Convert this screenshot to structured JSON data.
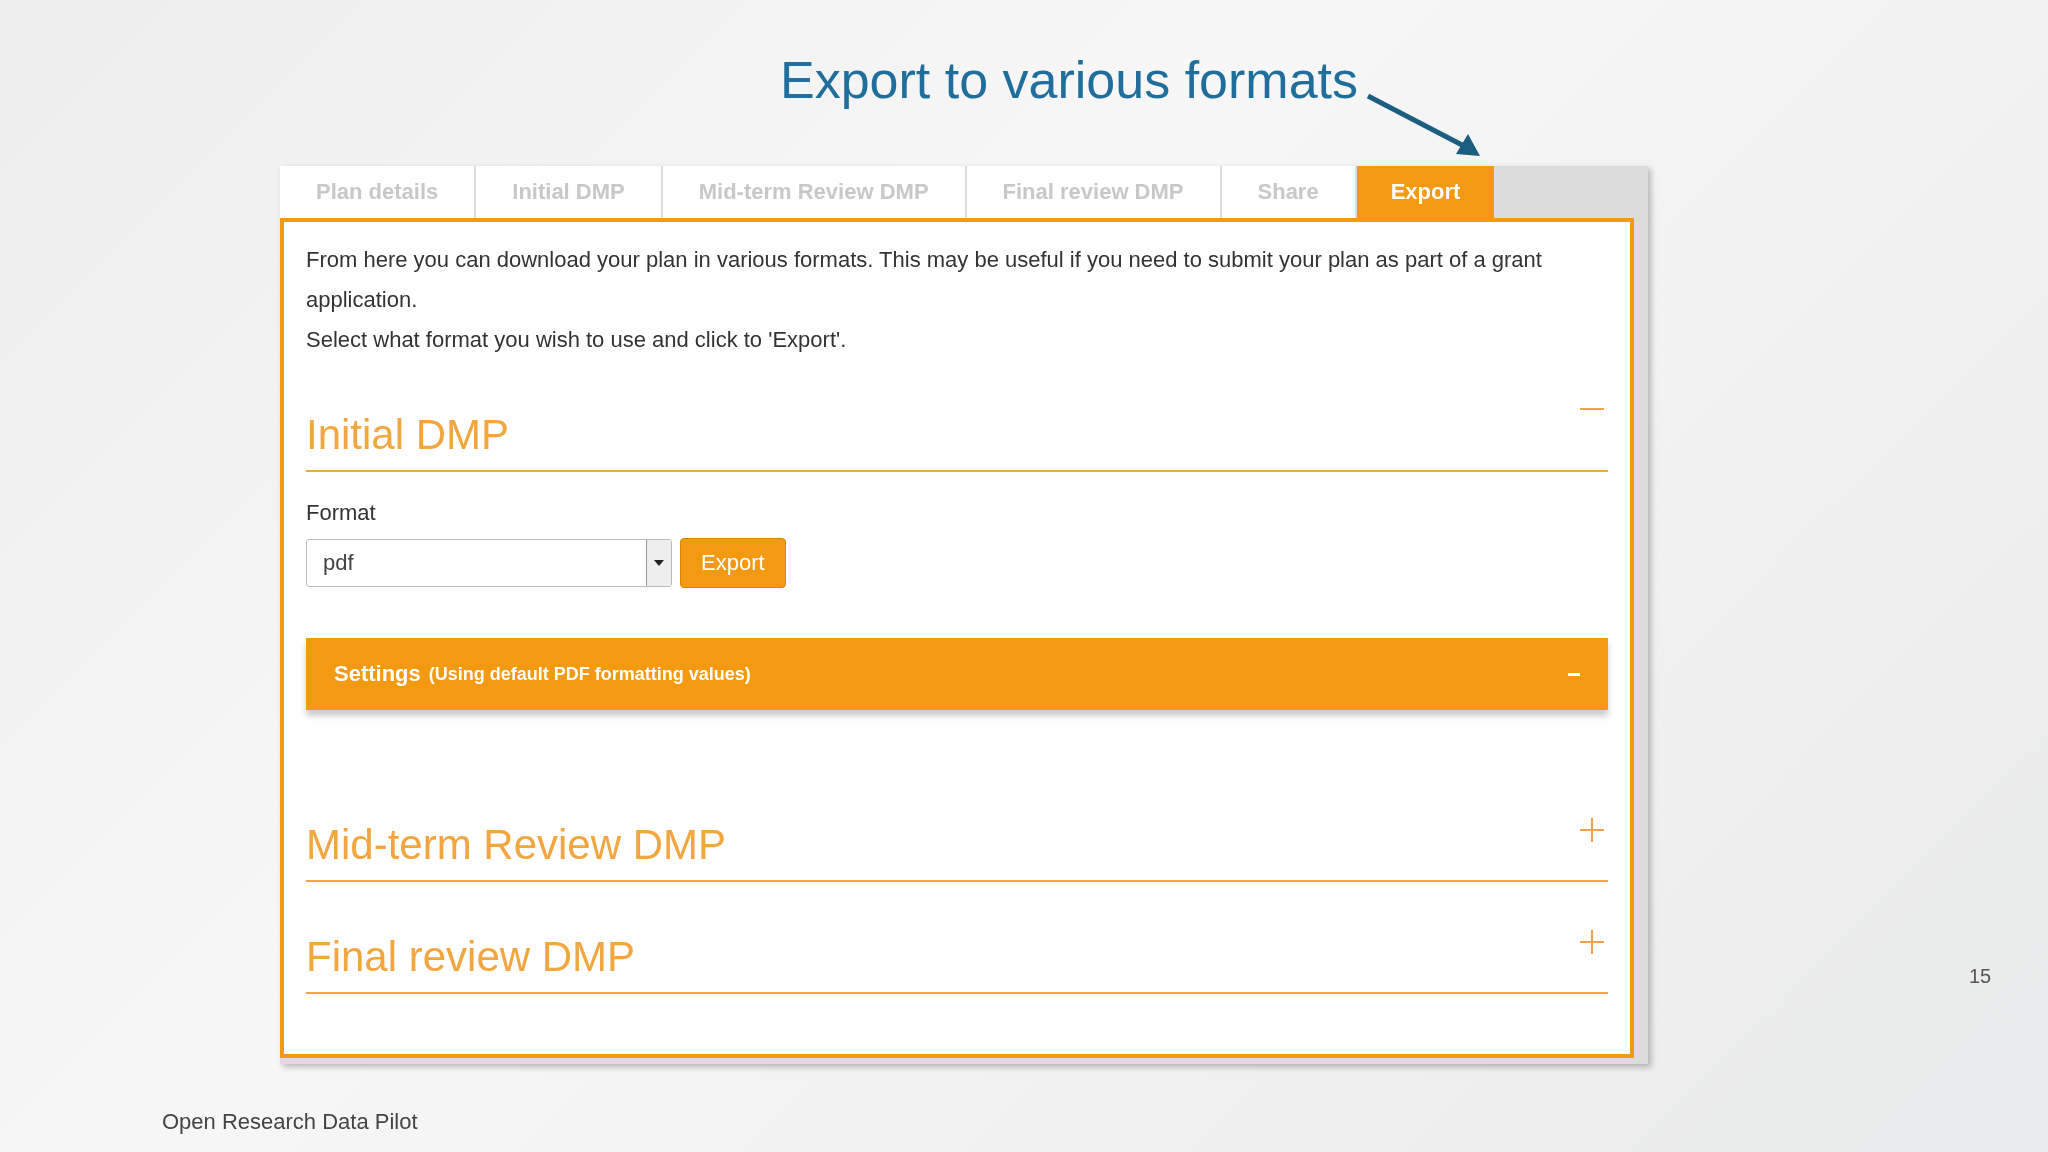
{
  "callout": {
    "text": "Export to various formats"
  },
  "tabs": [
    {
      "label": "Plan details",
      "selected": false
    },
    {
      "label": "Initial DMP",
      "selected": false
    },
    {
      "label": "Mid-term Review DMP",
      "selected": false
    },
    {
      "label": "Final review DMP",
      "selected": false
    },
    {
      "label": "Share",
      "selected": false
    },
    {
      "label": "Export",
      "selected": true
    }
  ],
  "intro": [
    "From here you can download your plan in various formats. This may be useful if you need to submit your plan as part of a grant application.",
    "Select what format you wish to use and click to 'Export'."
  ],
  "sections": [
    {
      "title": "Initial DMP",
      "expanded": true,
      "format_label": "Format",
      "format_value": "pdf",
      "export_button": "Export",
      "settings": {
        "label": "Settings",
        "note": "(Using default PDF formatting values)",
        "expanded": true
      }
    },
    {
      "title": "Mid-term Review DMP",
      "expanded": false
    },
    {
      "title": "Final review DMP",
      "expanded": false
    }
  ],
  "page_number": "15",
  "footer": "Open Research Data Pilot"
}
